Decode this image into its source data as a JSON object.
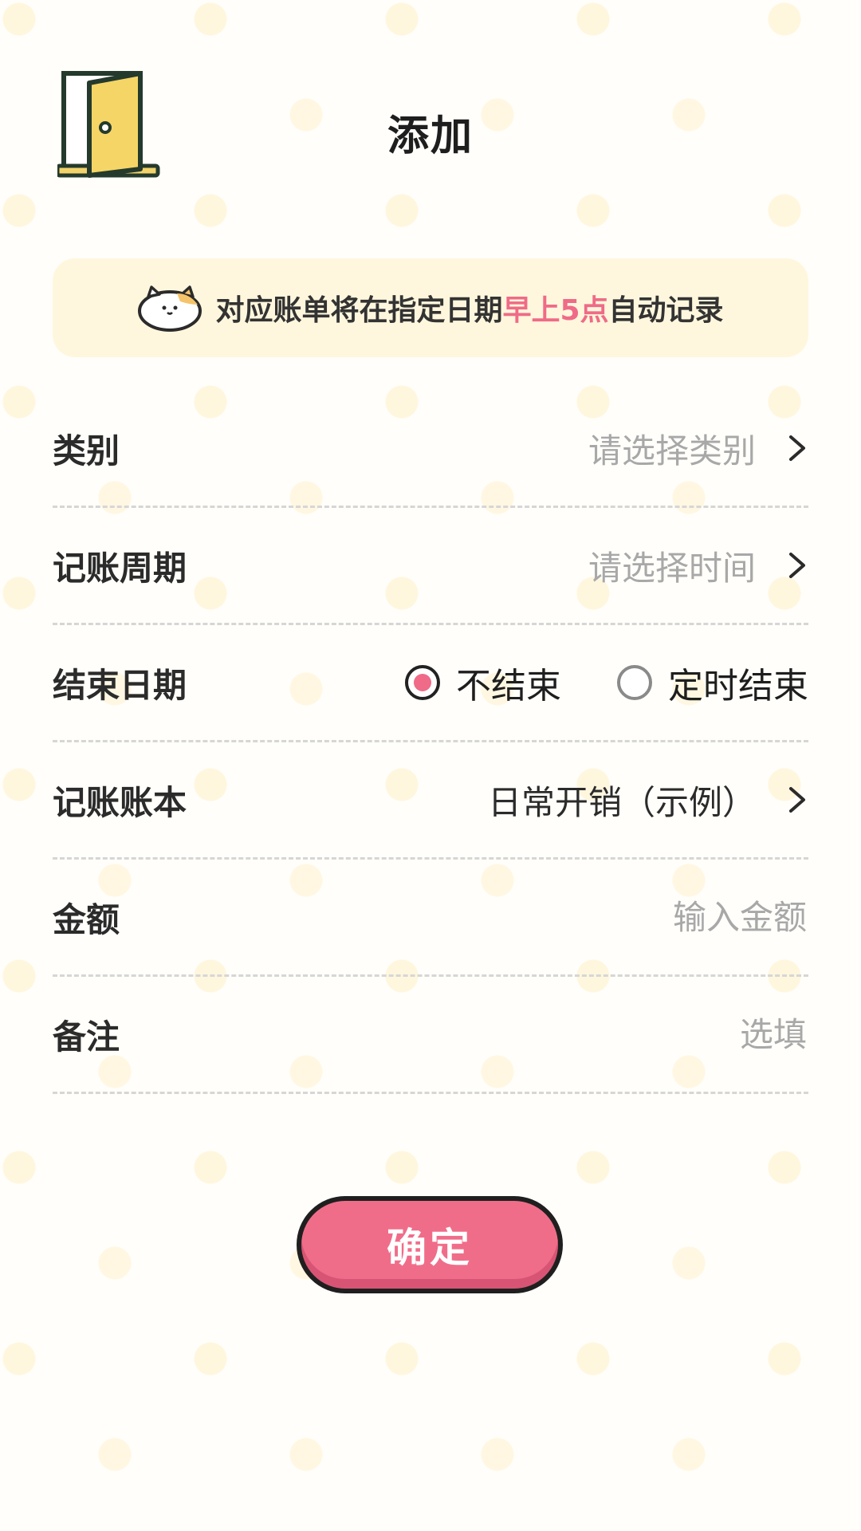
{
  "header": {
    "title": "添加",
    "back_icon": "door-exit-icon"
  },
  "notice": {
    "icon": "cat-face-icon",
    "text_before": "对应账单将在指定日期",
    "text_highlight": "早上5点",
    "text_after": "自动记录",
    "highlight_color": "#ef6b87"
  },
  "form": {
    "category": {
      "label": "类别",
      "placeholder": "请选择类别"
    },
    "cycle": {
      "label": "记账周期",
      "placeholder": "请选择时间"
    },
    "end_date": {
      "label": "结束日期",
      "options": [
        {
          "label": "不结束",
          "selected": true
        },
        {
          "label": "定时结束",
          "selected": false
        }
      ]
    },
    "book": {
      "label": "记账账本",
      "value": "日常开销（示例）"
    },
    "amount": {
      "label": "金额",
      "placeholder": "输入金额"
    },
    "note": {
      "label": "备注",
      "placeholder": "选填"
    }
  },
  "confirm": {
    "label": "确定",
    "color": "#f06d89"
  }
}
